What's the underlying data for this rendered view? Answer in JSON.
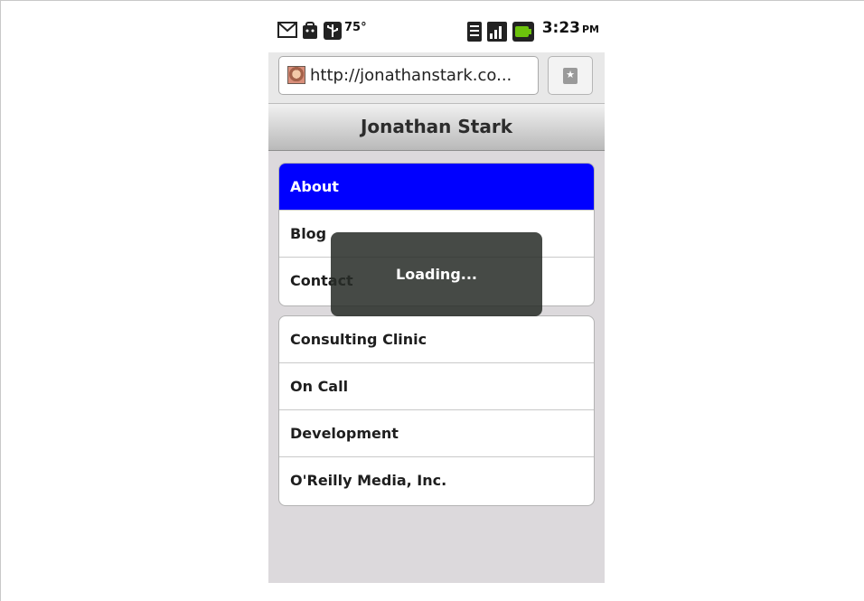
{
  "status_bar": {
    "icons": [
      "gmail-icon",
      "android-market-icon",
      "usb-icon",
      "wifi-icon",
      "signal-icon",
      "battery-icon"
    ],
    "temperature": "75°",
    "time": "3:23",
    "ampm": "PM"
  },
  "browser": {
    "url": "http://jonathanstark.co...",
    "bookmark_icon": "bookmark-icon"
  },
  "toolbar": {
    "title": "Jonathan Stark"
  },
  "lists": [
    {
      "items": [
        {
          "label": "About",
          "active": true
        },
        {
          "label": "Blog"
        },
        {
          "label": "Contact"
        }
      ]
    },
    {
      "items": [
        {
          "label": "Consulting Clinic"
        },
        {
          "label": "On Call"
        },
        {
          "label": "Development"
        },
        {
          "label": "O'Reilly Media, Inc."
        }
      ]
    }
  ],
  "overlay": {
    "message": "Loading..."
  },
  "colors": {
    "active_item": "#0000ff",
    "page_background": "#dcd9dc",
    "overlay": "#2b2f2b"
  }
}
